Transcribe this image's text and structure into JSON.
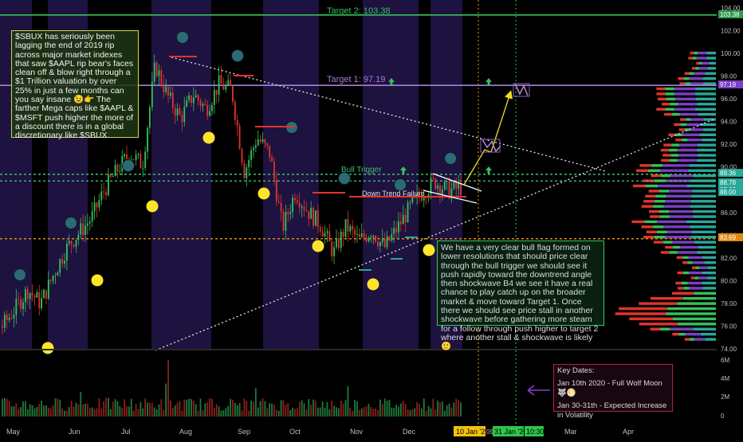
{
  "chart_data": {
    "type": "candlestick",
    "symbol": "SBUX",
    "ylim": [
      74,
      104
    ],
    "price_axis_ticks": [
      "104.00",
      "102.00",
      "100.00",
      "98.00",
      "96.00",
      "94.00",
      "92.00",
      "90.00",
      "88.00",
      "86.00",
      "84.00",
      "82.00",
      "80.00",
      "78.00",
      "76.00",
      "74.00"
    ],
    "volume_axis_ticks": [
      "6M",
      "4M",
      "2M",
      "0"
    ],
    "time_axis_ticks": [
      "May",
      "Jun",
      "Jul",
      "Aug",
      "Sep",
      "Oct",
      "Nov",
      "Dec",
      "Mar",
      "Apr"
    ],
    "highlighted_dates": [
      "10 Jan '20",
      "31 Jan '20"
    ],
    "time_axis_partial": [
      "09",
      "10:30"
    ],
    "price_badges": [
      {
        "label": "103.38",
        "color": "#2e9b4a"
      },
      {
        "label": "97.19",
        "color": "#7b3fc4"
      },
      {
        "label": "89.36",
        "color": "#2aa89a"
      },
      {
        "label": "88.78",
        "color": "#2aa89a"
      },
      {
        "label": "88.00",
        "color": "#2aa89a"
      },
      {
        "label": "88.00",
        "color": "#2aa89a"
      },
      {
        "label": "83.69",
        "color": "#e08a10"
      }
    ],
    "levels": [
      {
        "label": "Target 2: 103.38",
        "value": 103.38,
        "color": "#35c25a"
      },
      {
        "label": "Target 1: 97.19",
        "value": 97.19,
        "color": "#a67fd8"
      },
      {
        "label": "Bull Trigger",
        "value": 89.36,
        "color": "#3fbf6f"
      },
      {
        "label": "",
        "value": 88.78,
        "color": "#3fbf6f"
      },
      {
        "label": "",
        "value": 83.69,
        "color": "#e08a10"
      }
    ],
    "annotations": [
      "Down Trend Failure"
    ],
    "price_series": [
      {
        "d": "May",
        "v": 76
      },
      {
        "d": "May",
        "v": 77.5
      },
      {
        "d": "May",
        "v": 79.2
      },
      {
        "d": "Jun",
        "v": 78
      },
      {
        "d": "Jun",
        "v": 80.5
      },
      {
        "d": "Jun",
        "v": 82.8
      },
      {
        "d": "Jun",
        "v": 84.2
      },
      {
        "d": "Jul",
        "v": 85.5
      },
      {
        "d": "Jul",
        "v": 88
      },
      {
        "d": "Jul",
        "v": 89.7
      },
      {
        "d": "Jul",
        "v": 91.2
      },
      {
        "d": "Jul",
        "v": 90.2
      },
      {
        "d": "Aug",
        "v": 99
      },
      {
        "d": "Aug",
        "v": 96.2
      },
      {
        "d": "Aug",
        "v": 94.3
      },
      {
        "d": "Aug",
        "v": 96.4
      },
      {
        "d": "Aug",
        "v": 95.1
      },
      {
        "d": "Sep",
        "v": 97.3
      },
      {
        "d": "Sep",
        "v": 96.8
      },
      {
        "d": "Sep",
        "v": 89.6
      },
      {
        "d": "Sep",
        "v": 92.6
      },
      {
        "d": "Oct",
        "v": 91.2
      },
      {
        "d": "Oct",
        "v": 84.6
      },
      {
        "d": "Oct",
        "v": 87.8
      },
      {
        "d": "Oct",
        "v": 86.1
      },
      {
        "d": "Oct",
        "v": 84.9
      },
      {
        "d": "Nov",
        "v": 82.4
      },
      {
        "d": "Nov",
        "v": 84.8
      },
      {
        "d": "Nov",
        "v": 83.5
      },
      {
        "d": "Nov",
        "v": 84.4
      },
      {
        "d": "Nov",
        "v": 82.9
      },
      {
        "d": "Dec",
        "v": 84.6
      },
      {
        "d": "Dec",
        "v": 86.4
      },
      {
        "d": "Dec",
        "v": 87.8
      },
      {
        "d": "Dec",
        "v": 88.7
      },
      {
        "d": "Dec",
        "v": 87.9
      },
      {
        "d": "Dec",
        "v": 88.2
      }
    ]
  },
  "notes": {
    "left": "$SBUX has seriously been lagging the end of 2019 rip across major market indexes that saw $AAPL rip bear's faces clean off & blow right through a $1 Trillion valuation by over 25% in just a few months can you say insane 😉👉 The farther Mega caps like $AAPL & $MSFT push higher the more of a discount there is in a global discretionary like $SBUX.",
    "right": "We have a very clear bull flag formed on lower resolutions that should price clear through the bull trigger we should see it push rapidly toward the downtrend angle then shockwave B4 we see it have a real chance to play catch up on the broader market & move toward Target 1.  Once there we should see price stall in another shockwave before gathering more steam for a follow through push higher to target 2 where another stall & shockwave is likely 🙂",
    "dates_title": "Key Dates:",
    "dates_line1": "Jan 10th 2020 - Full Wolf Moon 🐺🌕",
    "dates_line2": "Jan 30-31th - Expected Increase in Volatility"
  },
  "colors": {
    "up": "#36c25a",
    "down": "#e0352c",
    "band": "#1e1240",
    "bg": "#000000",
    "axis_text": "#bfbfbf",
    "target2": "#35c25a",
    "target1": "#7b3fc4",
    "orange": "#e08a10",
    "teal": "#2aa89a"
  }
}
